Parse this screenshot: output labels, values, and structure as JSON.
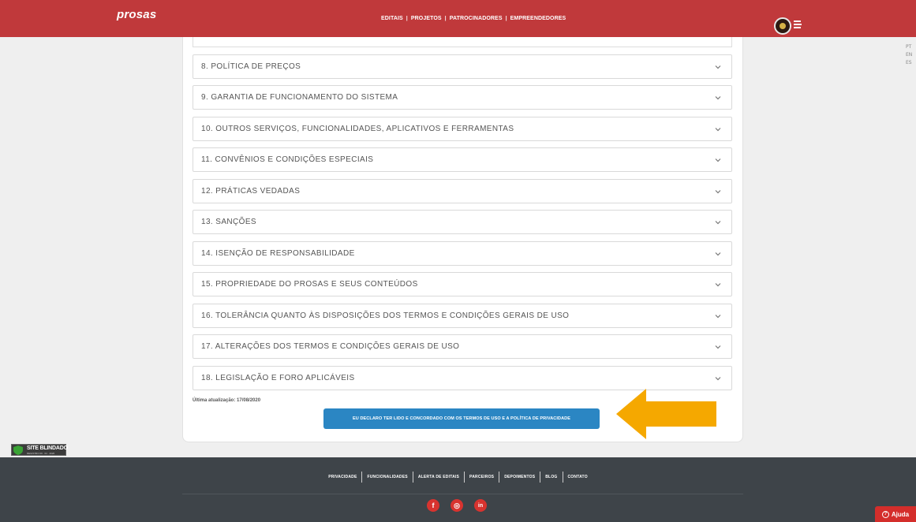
{
  "header": {
    "logo": "prosas",
    "nav": [
      "EDITAIS",
      "PROJETOS",
      "PATROCINADORES",
      "EMPREENDEDORES"
    ],
    "nav_separator": "|"
  },
  "languages": [
    "PT",
    "EN",
    "ES"
  ],
  "accordion": [
    "8. POLÍTICA DE PREÇOS",
    "9. GARANTIA DE FUNCIONAMENTO DO SISTEMA",
    "10. OUTROS SERVIÇOS, FUNCIONALIDADES, APLICATIVOS E FERRAMENTAS",
    "11. CONVÊNIOS E CONDIÇÕES ESPECIAIS",
    "12. PRÁTICAS VEDADAS",
    "13. SANÇÕES",
    "14. ISENÇÃO DE RESPONSABILIDADE",
    "15. PROPRIEDADE DO PROSAS E SEUS CONTEÚDOS",
    "16. TOLERÂNCIA QUANTO ÀS DISPOSIÇÕES DOS TERMOS E CONDIÇÕES GERAIS DE USO",
    "17. ALTERAÇÕES DOS TERMOS E CONDIÇÕES GERAIS DE USO",
    "18. LEGISLAÇÃO E FORO APLICÁVEIS"
  ],
  "last_updated": "Última atualização: 17/08/2020",
  "agree_button": "EU DECLARO TER LIDO E CONCORDADO COM OS TERMOS DE USO E A POLÍTICA DE PRIVACIDADE",
  "badge": {
    "title": "SITE BLINDADO",
    "subtitle": "REGISTRO 09 · 04 · 2020"
  },
  "footer": {
    "links": [
      "PRIVACIDADE",
      "FUNCIONALIDADES",
      "ALERTA DE EDITAIS",
      "PARCEIROS",
      "DEPOIMENTOS",
      "BLOG",
      "CONTATO"
    ],
    "social": [
      "f",
      "◎",
      "in"
    ]
  },
  "help_button": "Ajuda",
  "colors": {
    "brand_red": "#c0393b",
    "button_blue": "#2b86c3",
    "arrow_orange": "#f5a800",
    "footer_bg": "#3e4449"
  },
  "icons": {
    "accordion_toggle": "chevron-down-icon",
    "menu": "menu-icon",
    "help": "question-circle-icon"
  }
}
